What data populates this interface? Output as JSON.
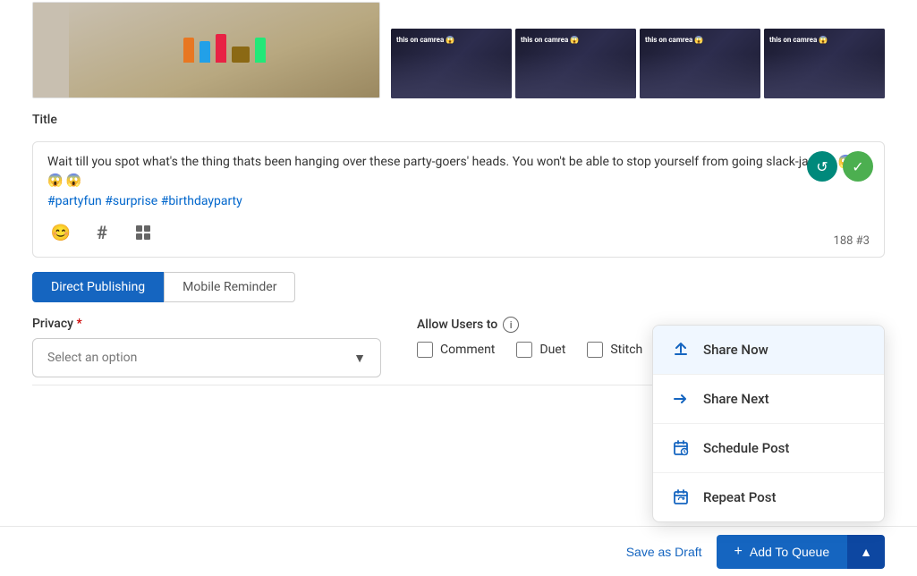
{
  "title": {
    "label": "Title"
  },
  "caption": {
    "text": "Wait till you spot what's the thing thats been hanging over these party-goers' heads. You won't be able to stop yourself from going slack-jawed! 😱 😱 😱",
    "hashtags": "#partyfun #surprise #birthdayparty",
    "char_count": "188 #3"
  },
  "tabs": {
    "direct_publishing": "Direct Publishing",
    "mobile_reminder": "Mobile Reminder"
  },
  "privacy": {
    "label": "Privacy",
    "required": "*",
    "placeholder": "Select an option"
  },
  "allow_users": {
    "label": "Allow Users to",
    "options": [
      {
        "id": "comment",
        "label": "Comment"
      },
      {
        "id": "duet",
        "label": "Duet"
      },
      {
        "id": "stitch",
        "label": "Stitch"
      }
    ]
  },
  "bottom_bar": {
    "save_draft": "Save as Draft",
    "add_queue": "Add To Queue"
  },
  "dropdown": {
    "items": [
      {
        "id": "share-now",
        "label": "Share Now",
        "icon": "upload"
      },
      {
        "id": "share-next",
        "label": "Share Next",
        "icon": "arrow-right"
      },
      {
        "id": "schedule-post",
        "label": "Schedule Post",
        "icon": "calendar"
      },
      {
        "id": "repeat-post",
        "label": "Repeat Post",
        "icon": "repeat"
      }
    ]
  },
  "thumbnails": [
    {
      "text": "this on camrea 😱"
    },
    {
      "text": "this on camrea 😱"
    },
    {
      "text": "this on camrea 😱"
    },
    {
      "text": "this on camrea 😱"
    }
  ],
  "icons": {
    "emoji": "😊",
    "hashtag": "#",
    "grid": "⊞",
    "info": "i",
    "upload": "⬆",
    "arrow_right": "→",
    "calendar": "📅",
    "repeat": "🔁",
    "chevron_down": "▼",
    "expand": "⊕",
    "plus_queue": "+"
  },
  "colors": {
    "primary": "#1565c0",
    "primary_dark": "#0d47a1",
    "text": "#333333",
    "hashtag_color": "#0066cc",
    "border": "#e0e0e0"
  }
}
